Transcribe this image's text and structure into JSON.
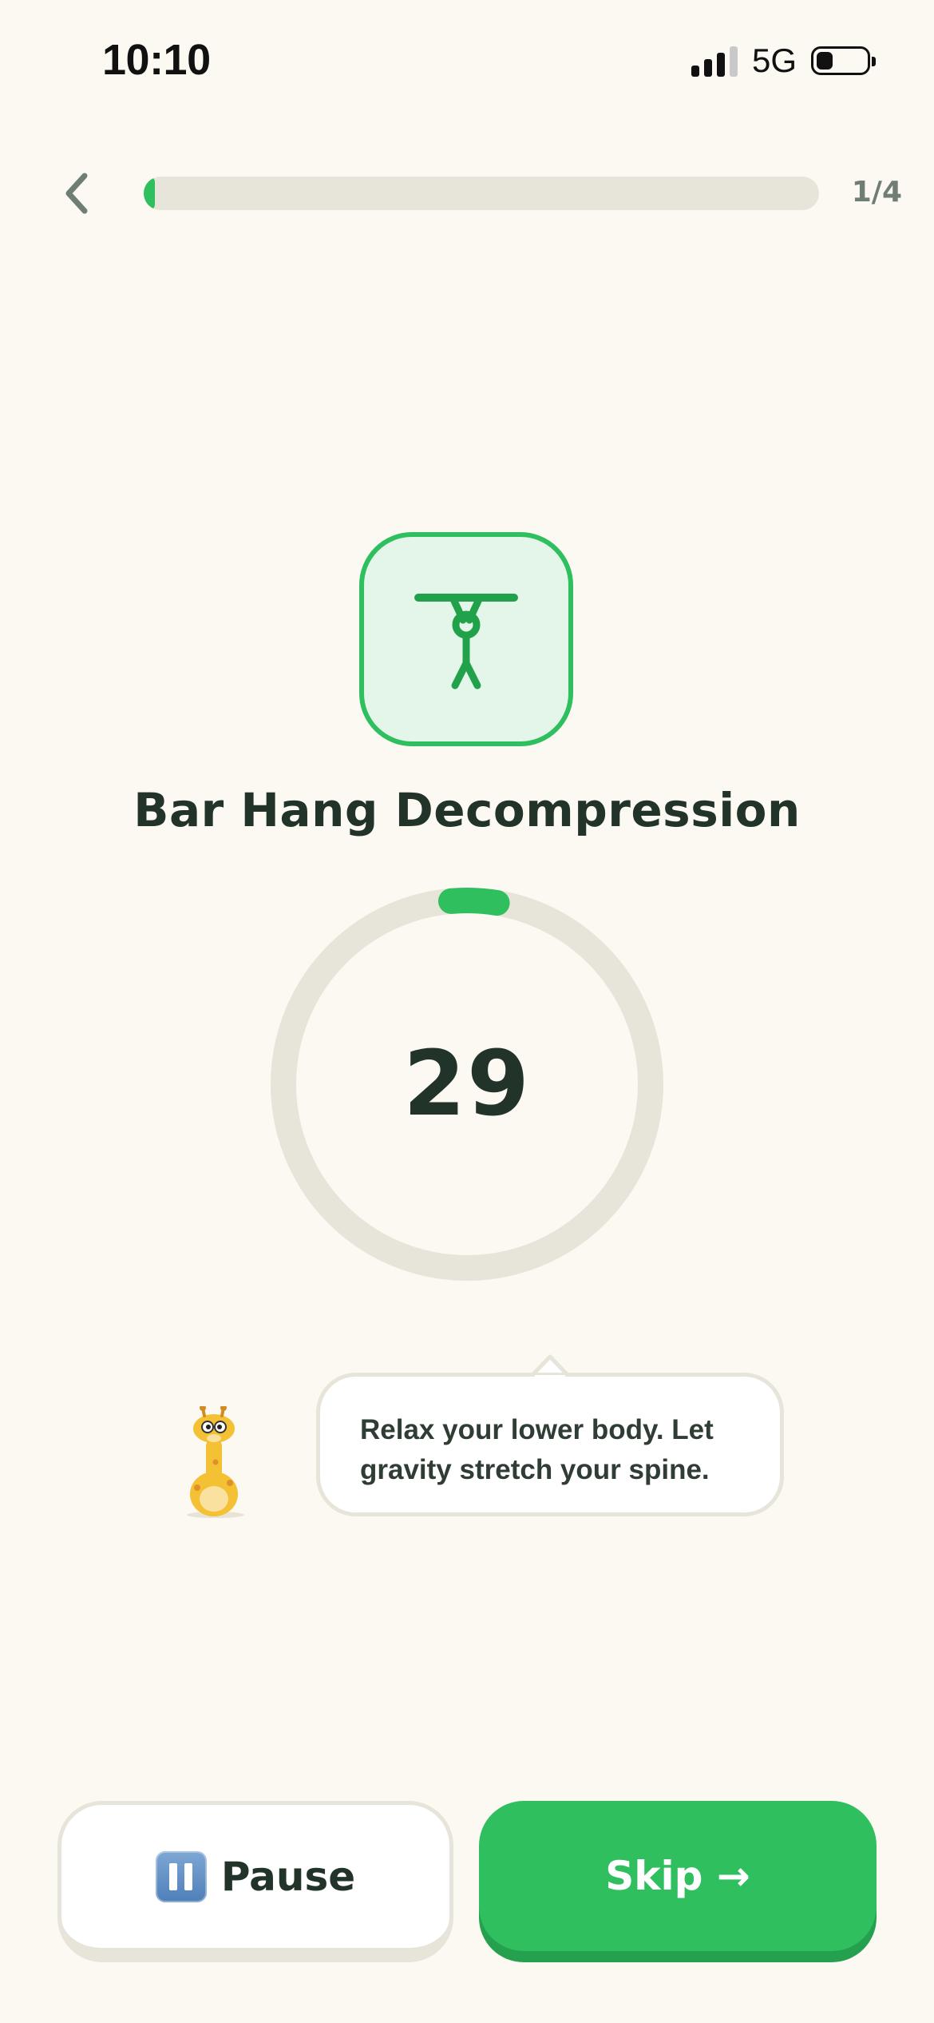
{
  "status_bar": {
    "time": "10:10",
    "network": "5G",
    "signal_bars": 3,
    "battery_level": 0.25
  },
  "header": {
    "progress_counter": "1/4",
    "progress_fraction": 0.01,
    "back_icon": "chevron-left-icon"
  },
  "exercise": {
    "icon": "bar-hang-figure-icon",
    "title": "Bar Hang Decompression",
    "timer_value": "29",
    "timer_progress_fraction": 0.04
  },
  "coach": {
    "mascot": "giraffe-mascot",
    "message": "Relax your lower body. Let gravity stretch your spine."
  },
  "actions": {
    "pause_icon": "pause-icon",
    "pause_label": "Pause",
    "skip_label": "Skip →"
  },
  "colors": {
    "accent": "#2fbf5f",
    "accent_dark": "#25a04f",
    "background": "#fbf9f2",
    "track": "#e7e4da",
    "text": "#22332a"
  }
}
